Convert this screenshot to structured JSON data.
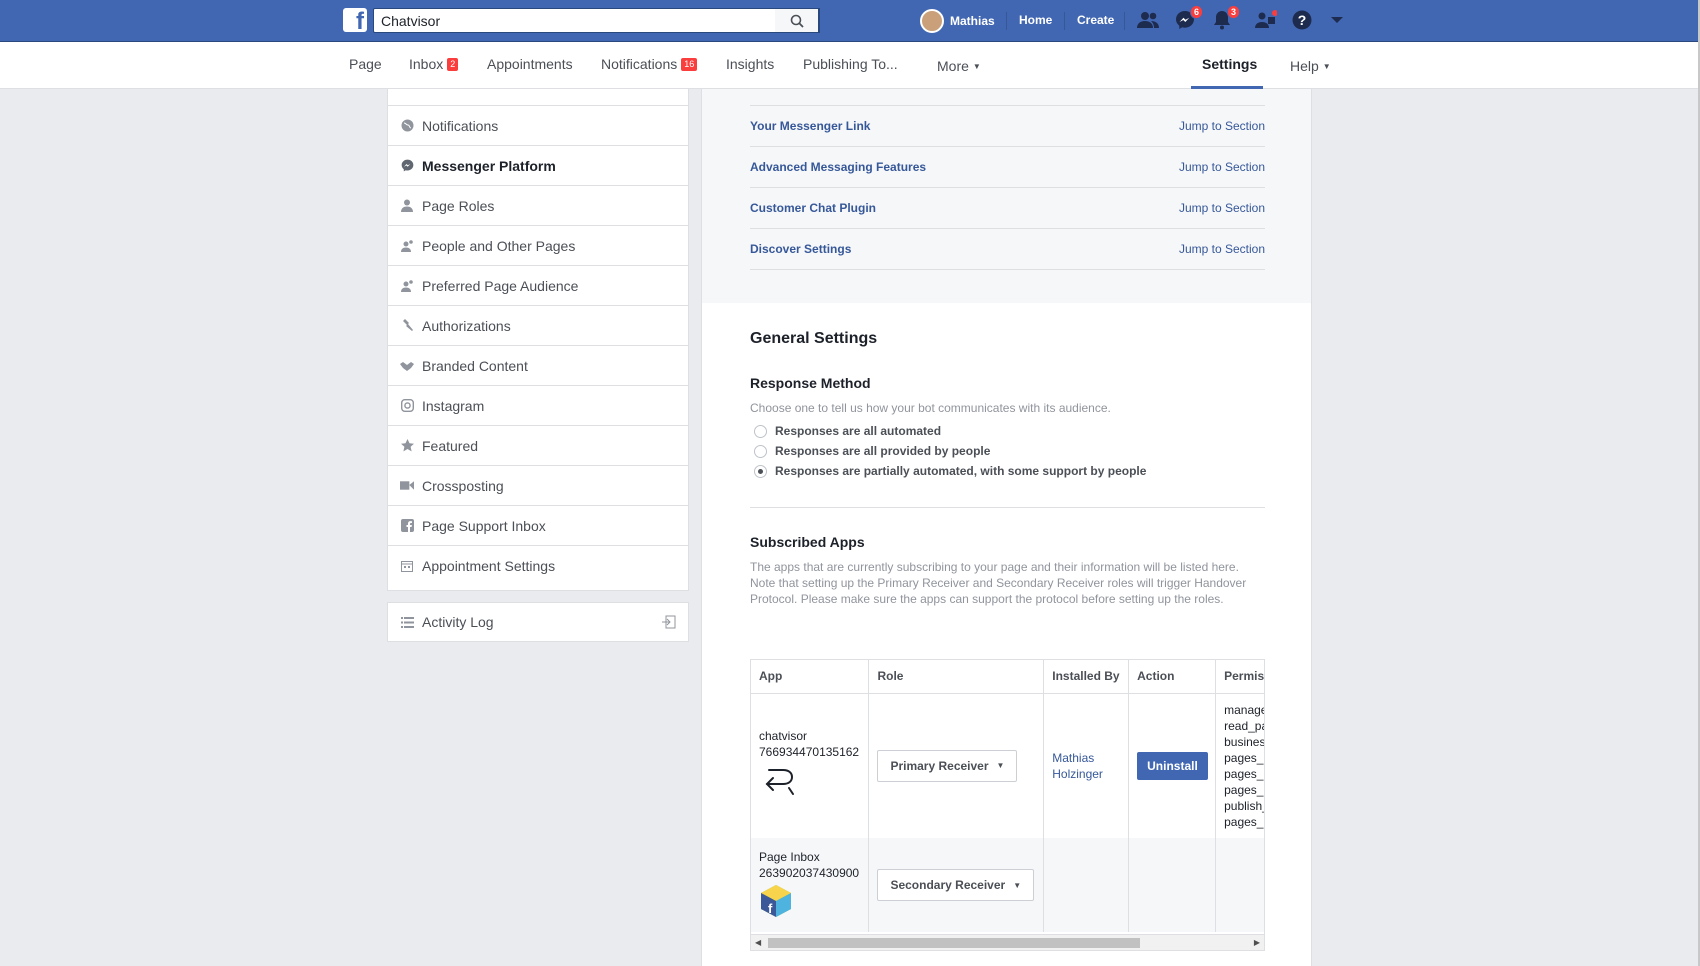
{
  "topbar": {
    "search_value": "Chatvisor",
    "user_name": "Mathias",
    "home": "Home",
    "create": "Create",
    "messenger_badge": "6",
    "notifications_badge": "3"
  },
  "tabs": {
    "page": "Page",
    "inbox": "Inbox",
    "inbox_badge": "2",
    "appointments": "Appointments",
    "notifications": "Notifications",
    "notifications_badge": "16",
    "insights": "Insights",
    "publishing": "Publishing To...",
    "more": "More",
    "settings": "Settings",
    "help": "Help"
  },
  "sidebar": {
    "items": [
      {
        "label": "Notifications",
        "icon": "globe-icon"
      },
      {
        "label": "Messenger Platform",
        "icon": "messenger-icon"
      },
      {
        "label": "Page Roles",
        "icon": "person-icon"
      },
      {
        "label": "People and Other Pages",
        "icon": "people-icon"
      },
      {
        "label": "Preferred Page Audience",
        "icon": "audience-icon"
      },
      {
        "label": "Authorizations",
        "icon": "wrench-icon"
      },
      {
        "label": "Branded Content",
        "icon": "handshake-icon"
      },
      {
        "label": "Instagram",
        "icon": "instagram-icon"
      },
      {
        "label": "Featured",
        "icon": "star-icon"
      },
      {
        "label": "Crossposting",
        "icon": "video-icon"
      },
      {
        "label": "Page Support Inbox",
        "icon": "facebook-icon"
      },
      {
        "label": "Appointment Settings",
        "icon": "calendar-icon"
      }
    ],
    "activity_log": "Activity Log"
  },
  "sections": [
    {
      "name": "Your Messenger Link",
      "jump": "Jump to Section"
    },
    {
      "name": "Advanced Messaging Features",
      "jump": "Jump to Section"
    },
    {
      "name": "Customer Chat Plugin",
      "jump": "Jump to Section"
    },
    {
      "name": "Discover Settings",
      "jump": "Jump to Section"
    }
  ],
  "general": {
    "title": "General Settings",
    "response_title": "Response Method",
    "response_desc": "Choose one to tell us how your bot communicates with its audience.",
    "options": [
      "Responses are all automated",
      "Responses are all provided by people",
      "Responses are partially automated, with some support by people"
    ],
    "selected_option": 2,
    "subscribed_title": "Subscribed Apps",
    "subscribed_desc": "The apps that are currently subscribing to your page and their information will be listed here. Note that setting up the Primary Receiver and Secondary Receiver roles will trigger Handover Protocol. Please make sure the apps can support the protocol before setting up the roles."
  },
  "table": {
    "headers": [
      "App",
      "Role",
      "Installed By",
      "Action",
      "Permiss"
    ],
    "rows": [
      {
        "app_name": "chatvisor",
        "app_id": "766934470135162",
        "role": "Primary Receiver",
        "installed_by": "Mathias Holzinger",
        "action": "Uninstall",
        "permissions": [
          "manage",
          "read_pa",
          "busines",
          "pages_r",
          "pages_r",
          "pages_r",
          "publish_",
          "pages_r"
        ]
      },
      {
        "app_name": "Page Inbox",
        "app_id": "263902037430900",
        "role": "Secondary Receiver",
        "installed_by": "",
        "action": "",
        "permissions": []
      }
    ]
  }
}
